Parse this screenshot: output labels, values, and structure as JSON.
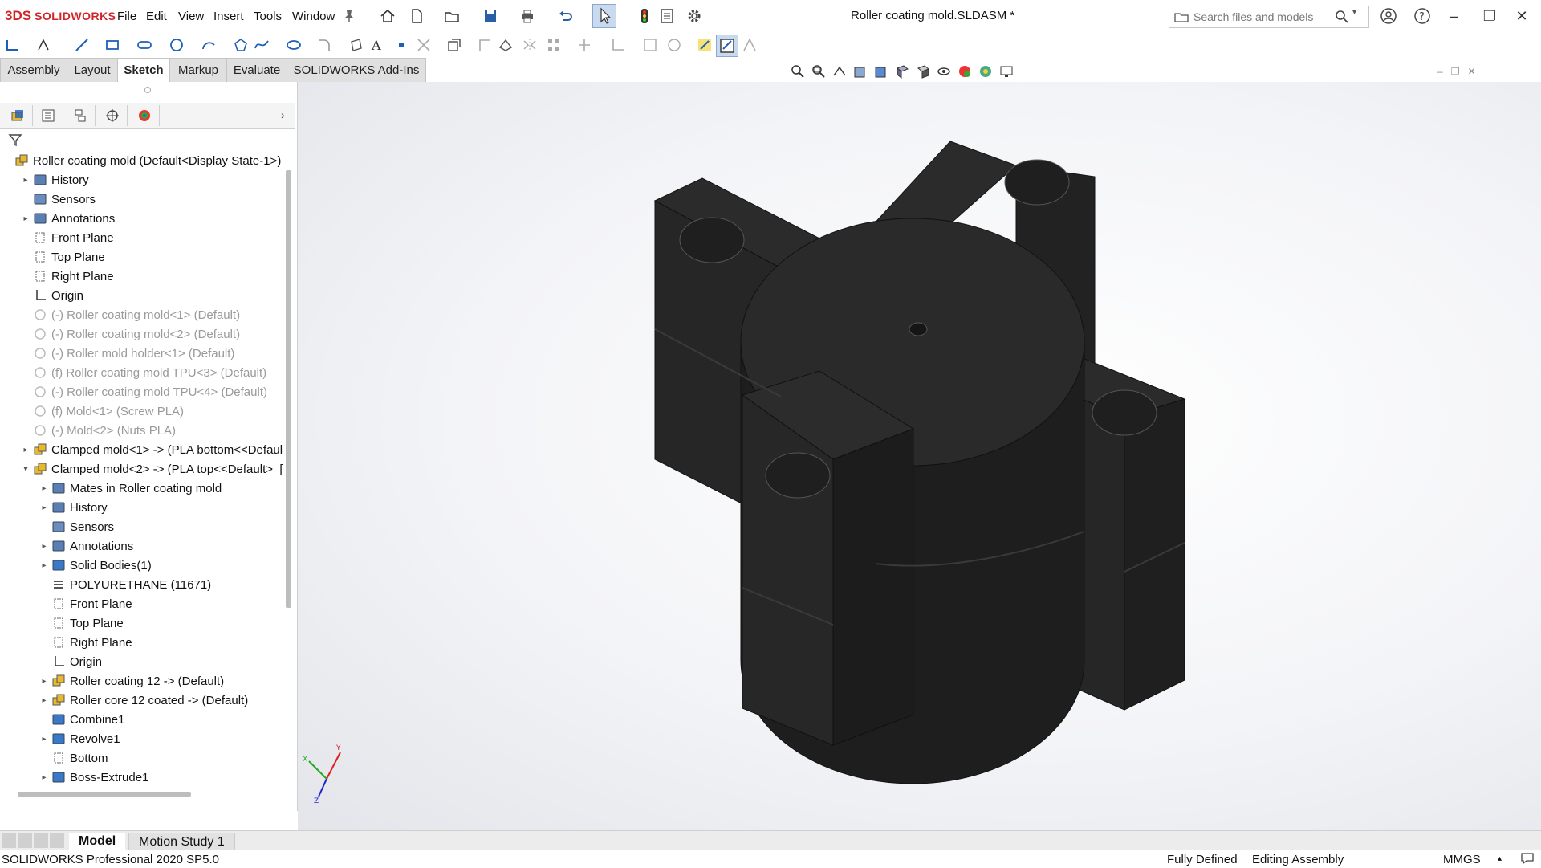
{
  "app": {
    "logo_mark": "3DS",
    "logo_text": "SOLIDWORKS",
    "title": "Roller coating mold.SLDASM *"
  },
  "menu": [
    "File",
    "Edit",
    "View",
    "Insert",
    "Tools",
    "Window"
  ],
  "search": {
    "placeholder": "Search files and models"
  },
  "command_tabs": [
    "Assembly",
    "Layout",
    "Sketch",
    "Markup",
    "Evaluate",
    "SOLIDWORKS Add-Ins"
  ],
  "active_command_tab": "Sketch",
  "tree": [
    {
      "label": "Roller coating mold  (Default<Display State-1>)",
      "icon": "assembly-icon",
      "indent": 0,
      "arrow": "",
      "dim": false
    },
    {
      "label": "History",
      "icon": "history-folder-icon",
      "indent": 1,
      "arrow": "right",
      "dim": false
    },
    {
      "label": "Sensors",
      "icon": "sensors-icon",
      "indent": 1,
      "arrow": "",
      "dim": false
    },
    {
      "label": "Annotations",
      "icon": "annotations-icon",
      "indent": 1,
      "arrow": "right",
      "dim": false
    },
    {
      "label": "Front Plane",
      "icon": "plane-icon",
      "indent": 1,
      "arrow": "",
      "dim": false
    },
    {
      "label": "Top Plane",
      "icon": "plane-icon",
      "indent": 1,
      "arrow": "",
      "dim": false
    },
    {
      "label": "Right Plane",
      "icon": "plane-icon",
      "indent": 1,
      "arrow": "",
      "dim": false
    },
    {
      "label": "Origin",
      "icon": "origin-icon",
      "indent": 1,
      "arrow": "",
      "dim": false
    },
    {
      "label": "(-) Roller coating mold<1> (Default)",
      "icon": "part-icon",
      "indent": 1,
      "arrow": "",
      "dim": true
    },
    {
      "label": "(-) Roller coating mold<2> (Default)",
      "icon": "part-icon",
      "indent": 1,
      "arrow": "",
      "dim": true
    },
    {
      "label": "(-) Roller mold holder<1> (Default)",
      "icon": "part-icon",
      "indent": 1,
      "arrow": "",
      "dim": true
    },
    {
      "label": "(f) Roller coating mold TPU<3> (Default)",
      "icon": "part-icon",
      "indent": 1,
      "arrow": "",
      "dim": true
    },
    {
      "label": "(-) Roller coating mold TPU<4> (Default)",
      "icon": "part-icon",
      "indent": 1,
      "arrow": "",
      "dim": true
    },
    {
      "label": "(f) Mold<1> (Screw PLA)",
      "icon": "part-icon",
      "indent": 1,
      "arrow": "",
      "dim": true
    },
    {
      "label": "(-) Mold<2> (Nuts PLA)",
      "icon": "part-icon",
      "indent": 1,
      "arrow": "",
      "dim": true
    },
    {
      "label": "Clamped mold<1> -> (PLA bottom<<Defaul",
      "icon": "subassembly-icon",
      "indent": 1,
      "arrow": "right",
      "dim": false
    },
    {
      "label": "Clamped mold<2> -> (PLA top<<Default>_[",
      "icon": "subassembly-icon",
      "indent": 1,
      "arrow": "down",
      "dim": false
    },
    {
      "label": "Mates in Roller coating mold",
      "icon": "mates-folder-icon",
      "indent": 2,
      "arrow": "right",
      "dim": false
    },
    {
      "label": "History",
      "icon": "history-folder-icon",
      "indent": 2,
      "arrow": "right",
      "dim": false
    },
    {
      "label": "Sensors",
      "icon": "sensors-icon",
      "indent": 2,
      "arrow": "",
      "dim": false
    },
    {
      "label": "Annotations",
      "icon": "annotations-icon",
      "indent": 2,
      "arrow": "right",
      "dim": false
    },
    {
      "label": "Solid Bodies(1)",
      "icon": "solid-bodies-icon",
      "indent": 2,
      "arrow": "right",
      "dim": false
    },
    {
      "label": "POLYURETHANE (11671)",
      "icon": "material-icon",
      "indent": 2,
      "arrow": "",
      "dim": false
    },
    {
      "label": "Front Plane",
      "icon": "plane-icon",
      "indent": 2,
      "arrow": "",
      "dim": false
    },
    {
      "label": "Top Plane",
      "icon": "plane-icon",
      "indent": 2,
      "arrow": "",
      "dim": false
    },
    {
      "label": "Right Plane",
      "icon": "plane-icon",
      "indent": 2,
      "arrow": "",
      "dim": false
    },
    {
      "label": "Origin",
      "icon": "origin-icon",
      "indent": 2,
      "arrow": "",
      "dim": false
    },
    {
      "label": "Roller coating 12 -> (Default)",
      "icon": "subassembly-icon",
      "indent": 2,
      "arrow": "right",
      "dim": false
    },
    {
      "label": "Roller core 12 coated -> (Default)",
      "icon": "subassembly-icon",
      "indent": 2,
      "arrow": "right",
      "dim": false
    },
    {
      "label": "Combine1",
      "icon": "combine-icon",
      "indent": 2,
      "arrow": "",
      "dim": false
    },
    {
      "label": "Revolve1",
      "icon": "revolve-icon",
      "indent": 2,
      "arrow": "right",
      "dim": false
    },
    {
      "label": "Bottom",
      "icon": "plane-icon",
      "indent": 2,
      "arrow": "",
      "dim": false
    },
    {
      "label": "Boss-Extrude1",
      "icon": "extrude-icon",
      "indent": 2,
      "arrow": "right",
      "dim": false
    }
  ],
  "bottom_tabs": [
    "Model",
    "Motion Study 1"
  ],
  "status": {
    "product": "SOLIDWORKS Professional 2020 SP5.0",
    "defined": "Fully Defined",
    "mode": "Editing Assembly",
    "units": "MMGS"
  },
  "colors": {
    "brand": "#d0262b",
    "model": "#262626",
    "accent_blue": "#1f5fb8"
  }
}
